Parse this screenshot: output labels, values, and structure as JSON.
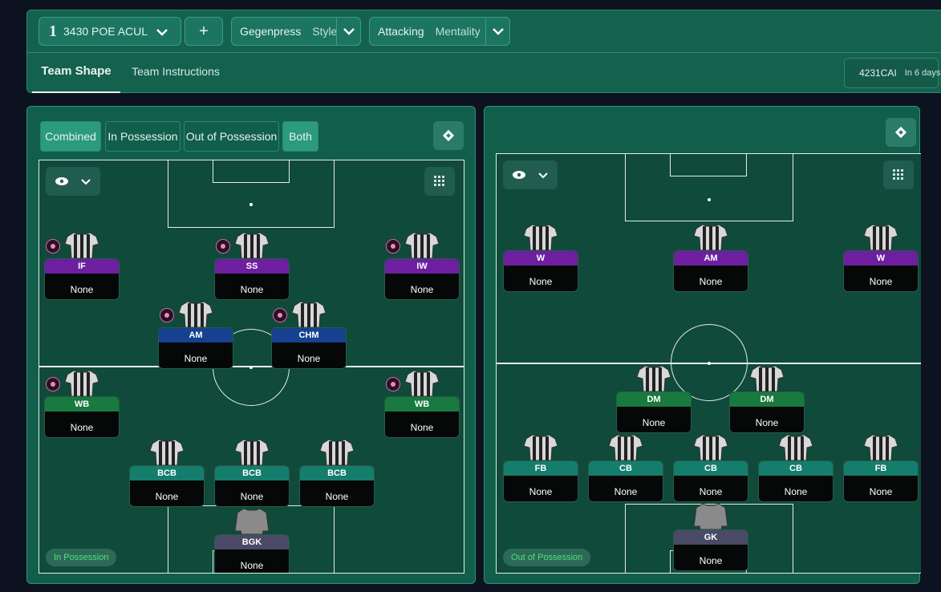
{
  "header": {
    "tactic_number": "1",
    "tactic_name": "3430 POE ACUL",
    "add_label": "+",
    "style": {
      "value": "Gegenpress",
      "label": "Style"
    },
    "mentality": {
      "value": "Attacking",
      "label": "Mentality"
    }
  },
  "tabs": [
    {
      "label": "Team Shape",
      "active": true
    },
    {
      "label": "Team Instructions",
      "active": false
    }
  ],
  "schedule": {
    "opponent": "4231CAI",
    "when": "In 6 days"
  },
  "left_panel": {
    "segments": [
      {
        "label": "Combined",
        "active": true
      },
      {
        "label": "In Possession",
        "active": false
      },
      {
        "label": "Out of Possession",
        "active": false
      },
      {
        "label": "Both",
        "active": true
      }
    ],
    "mode_label": "In Possession",
    "players": [
      {
        "role": "IF",
        "duty": "None",
        "color": "purple",
        "badge": true
      },
      {
        "role": "SS",
        "duty": "None",
        "color": "purple",
        "badge": true
      },
      {
        "role": "IW",
        "duty": "None",
        "color": "purple",
        "badge": true
      },
      {
        "role": "AM",
        "duty": "None",
        "color": "blue",
        "badge": true
      },
      {
        "role": "CHM",
        "duty": "None",
        "color": "blue",
        "badge": true
      },
      {
        "role": "WB",
        "duty": "None",
        "color": "green",
        "badge": true
      },
      {
        "role": "WB",
        "duty": "None",
        "color": "green",
        "badge": true
      },
      {
        "role": "BCB",
        "duty": "None",
        "color": "teal",
        "badge": false
      },
      {
        "role": "BCB",
        "duty": "None",
        "color": "teal",
        "badge": false
      },
      {
        "role": "BCB",
        "duty": "None",
        "color": "teal",
        "badge": false
      },
      {
        "role": "BGK",
        "duty": "None",
        "color": "grey",
        "badge": false
      }
    ]
  },
  "right_panel": {
    "mode_label": "Out of Possession",
    "players": [
      {
        "role": "W",
        "duty": "None",
        "color": "purple"
      },
      {
        "role": "AM",
        "duty": "None",
        "color": "purple"
      },
      {
        "role": "W",
        "duty": "None",
        "color": "purple"
      },
      {
        "role": "DM",
        "duty": "None",
        "color": "green"
      },
      {
        "role": "DM",
        "duty": "None",
        "color": "green"
      },
      {
        "role": "FB",
        "duty": "None",
        "color": "teal"
      },
      {
        "role": "CB",
        "duty": "None",
        "color": "teal"
      },
      {
        "role": "CB",
        "duty": "None",
        "color": "teal"
      },
      {
        "role": "CB",
        "duty": "None",
        "color": "teal"
      },
      {
        "role": "FB",
        "duty": "None",
        "color": "teal"
      },
      {
        "role": "GK",
        "duty": "None",
        "color": "grey"
      }
    ]
  },
  "icons": {
    "chevron": "chevron-down-icon",
    "view": "eye-icon",
    "grid": "grid-icon",
    "pitch_toggle": "swap-icon",
    "badge": "role-badge-icon"
  }
}
